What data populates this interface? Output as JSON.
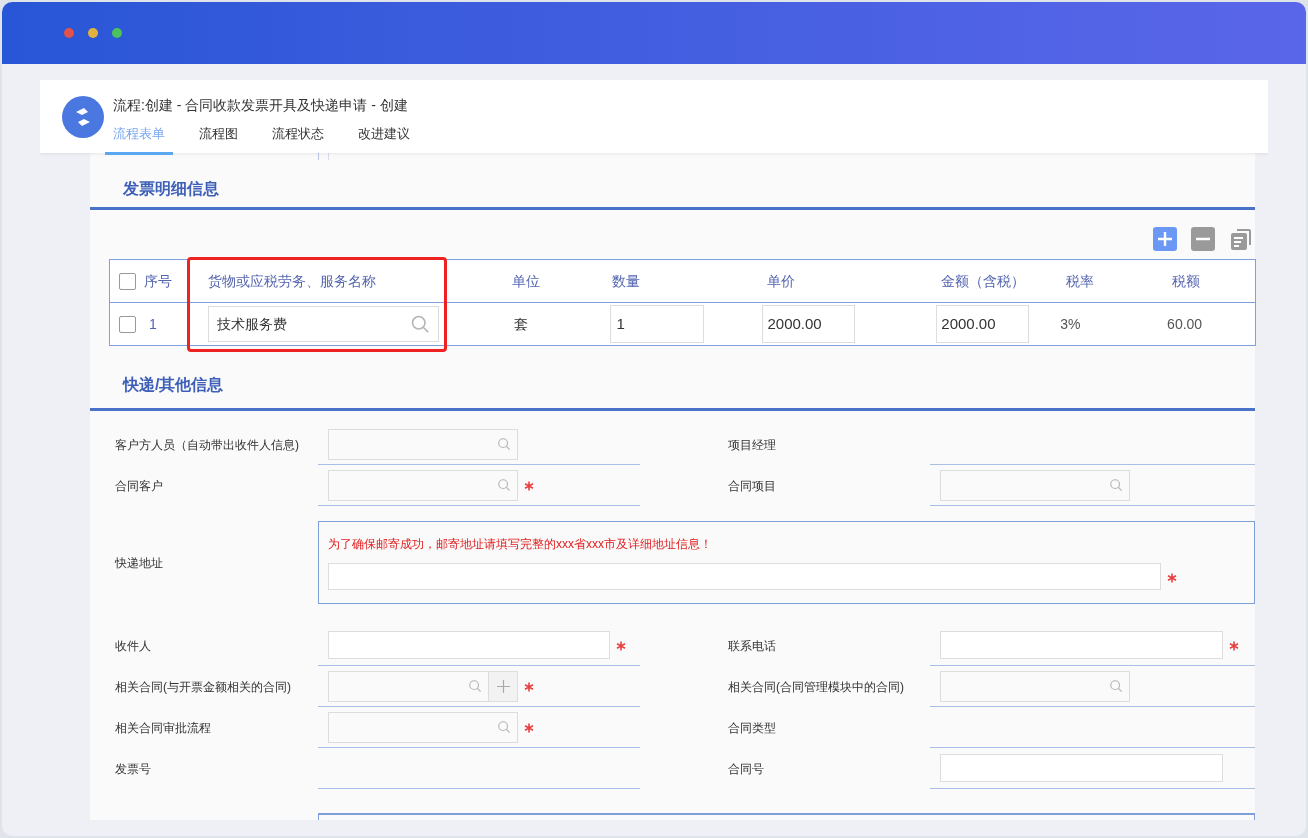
{
  "window": {
    "title": "流程:创建 - 合同收款发票开具及快递申请 - 创建"
  },
  "tabs": [
    {
      "label": "流程表单",
      "selected": true
    },
    {
      "label": "流程图",
      "selected": false
    },
    {
      "label": "流程状态",
      "selected": false
    },
    {
      "label": "改进建议",
      "selected": false
    }
  ],
  "invoice": {
    "title": "发票明细信息",
    "columns": [
      "序号",
      "货物或应税劳务、服务名称",
      "单位",
      "数量",
      "单价",
      "金额（含税）",
      "税率",
      "税额"
    ],
    "header_checked": false,
    "rows": [
      {
        "checked": false,
        "index": "1",
        "name": "技术服务费",
        "unit": "套",
        "quantity": "1",
        "price": "2000.00",
        "amount": "2000.00",
        "rate": "3%",
        "tax": "60.00"
      }
    ]
  },
  "express": {
    "title": "快递/其他信息",
    "rows": [
      {
        "kind": "pair",
        "cells": [
          {
            "label": "客户方人员（自动带出收件人信息)",
            "kind": "lookup",
            "required": false
          },
          {
            "label": "项目经理",
            "kind": "none",
            "required": false
          }
        ]
      },
      {
        "kind": "pair",
        "cells": [
          {
            "label": "合同客户",
            "kind": "lookup",
            "required": true
          },
          {
            "label": "合同项目",
            "kind": "lookup",
            "required": false
          }
        ]
      },
      {
        "kind": "wide",
        "label": "快递地址",
        "note": "为了确保邮寄成功，邮寄地址请填写完整的xxx省xxx市及详细地址信息！",
        "required": true
      },
      {
        "kind": "pair",
        "cells": [
          {
            "label": "收件人",
            "kind": "text",
            "required": true
          },
          {
            "label": "联系电话",
            "kind": "text",
            "required": true
          }
        ]
      },
      {
        "kind": "pair",
        "cells": [
          {
            "label": "相关合同(与开票金额相关的合同)",
            "kind": "lookup_add",
            "required": true
          },
          {
            "label": "相关合同(合同管理模块中的合同)",
            "kind": "lookup",
            "required": false
          }
        ]
      },
      {
        "kind": "pair",
        "cells": [
          {
            "label": "相关合同审批流程",
            "kind": "lookup",
            "required": true
          },
          {
            "label": "合同类型",
            "kind": "none",
            "required": false
          }
        ]
      },
      {
        "kind": "pair",
        "cells": [
          {
            "label": "发票号",
            "kind": "none",
            "required": false
          },
          {
            "label": "合同号",
            "kind": "text",
            "required": false
          }
        ]
      }
    ]
  }
}
